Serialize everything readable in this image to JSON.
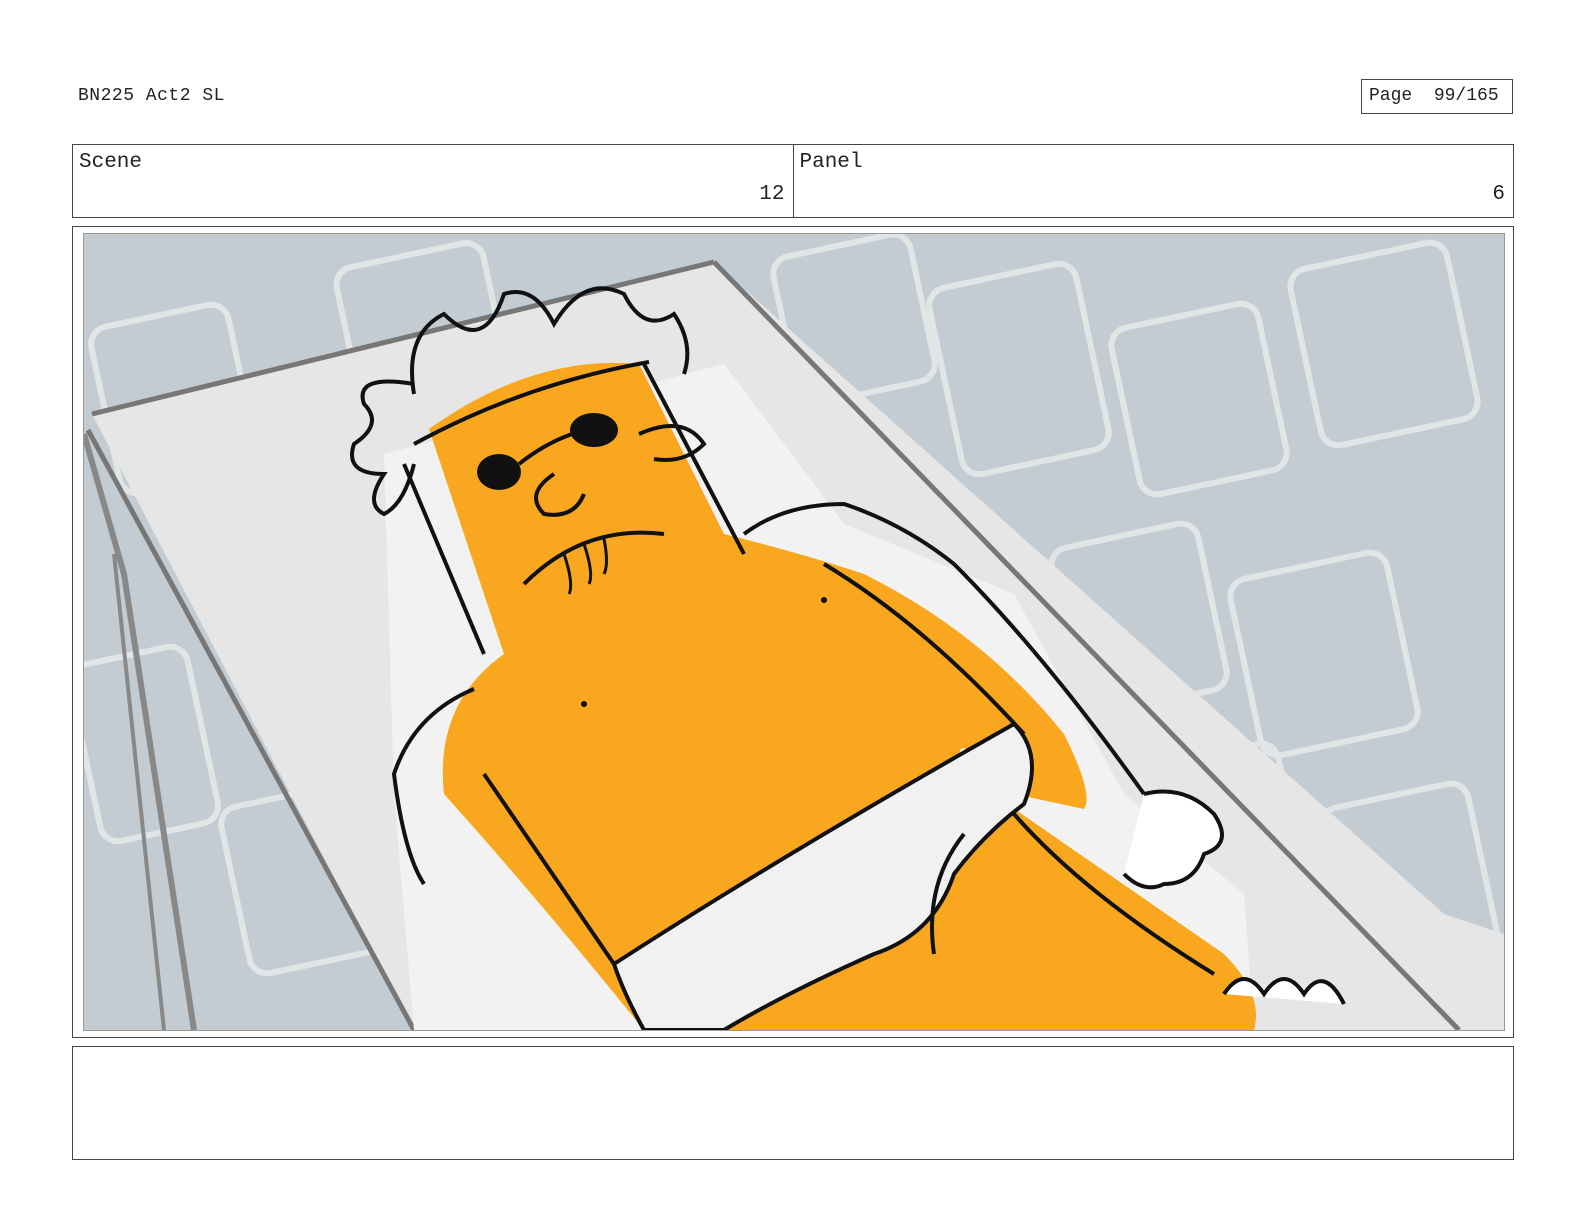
{
  "header": {
    "doc_title": "BN225 Act2 SL",
    "page_label": "Page",
    "page_number": "99/165"
  },
  "info": {
    "scene_label": "Scene",
    "scene_value": "12",
    "panel_label": "Panel",
    "panel_value": "6"
  },
  "artwork": {
    "description_icon": "storyboard-sketch",
    "colors": {
      "background": "#c2ccd2",
      "tile_lines": "#e8eaea",
      "lounger": "#e6e6e6",
      "lounger_edge": "#777777",
      "character": "#f9a71e",
      "outline": "#111111",
      "hair": "#ffffff",
      "briefs": "#f1f1f1"
    }
  },
  "notes": {
    "text": ""
  }
}
